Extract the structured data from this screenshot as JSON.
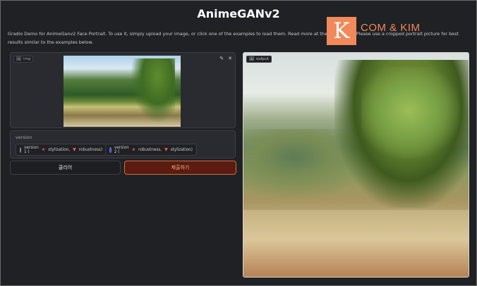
{
  "app": {
    "title": "AnimeGANv2",
    "description": "Gradio Demo for AnimeGanv2 Face Portrait. To use it, simply upload your image, or click one of the examples to load them. Read more at the links below. Please use a cropped portrait picture for best results similar to the examples below."
  },
  "watermark": {
    "mark": "K",
    "text": "COM & KIM"
  },
  "input_image": {
    "tag_label": "img",
    "edit_icon": "pencil-icon",
    "close_icon": "close-icon"
  },
  "version": {
    "label": "version",
    "options": [
      {
        "prefix": "version 1 (",
        "stylization": "stylization,",
        "robustness": "robustness)",
        "selected": false
      },
      {
        "prefix": "version 2 (",
        "robustness": "robustness,",
        "stylization": "stylization)",
        "selected": true
      }
    ]
  },
  "buttons": {
    "clear": "클리어",
    "submit": "제출하기"
  },
  "output": {
    "tag_label": "output"
  }
}
